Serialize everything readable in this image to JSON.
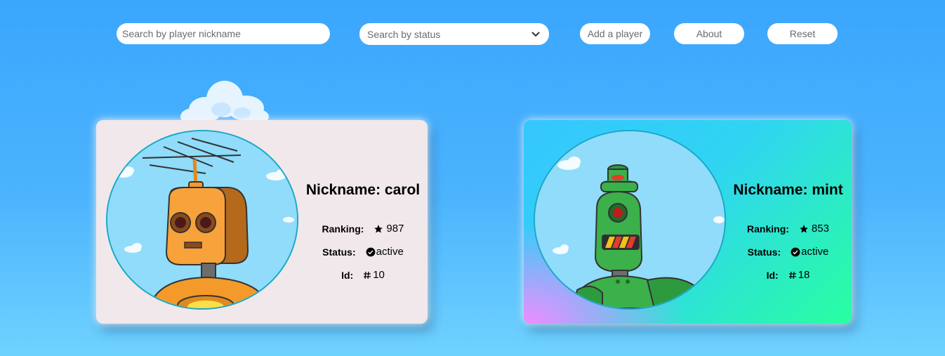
{
  "toolbar": {
    "nickname_search_placeholder": "Search by player nickname",
    "status_select_value": "Search by status",
    "add_player_label": "Add a player",
    "about_label": "About",
    "reset_label": "Reset"
  },
  "players": [
    {
      "nickname_text": "Nickname: carol",
      "ranking_label": "Ranking:",
      "ranking_value": "987",
      "status_label": "Status:",
      "status_value": "active",
      "id_label": "Id:",
      "id_value": "10",
      "robot": "orange-antenna-robot"
    },
    {
      "nickname_text": "Nickname: mint",
      "ranking_label": "Ranking:",
      "ranking_value": "853",
      "status_label": "Status:",
      "status_value": "active",
      "id_label": "Id:",
      "id_value": "18",
      "robot": "green-cyclops-robot"
    }
  ],
  "icons": {
    "ranking": "star-icon",
    "status": "check-circle-icon",
    "id": "hash-icon",
    "select": "chevron-down-icon"
  },
  "colors": {
    "background_top": "#3aa6fd",
    "background_bottom": "#6fd2fe",
    "card1_background": "#f0e8ea",
    "card2_gradient_start": "#35c6ff",
    "card2_gradient_end": "#28ffa0",
    "card2_corner_accent": "#f08cff",
    "avatar_border": "#1aa7c9"
  }
}
